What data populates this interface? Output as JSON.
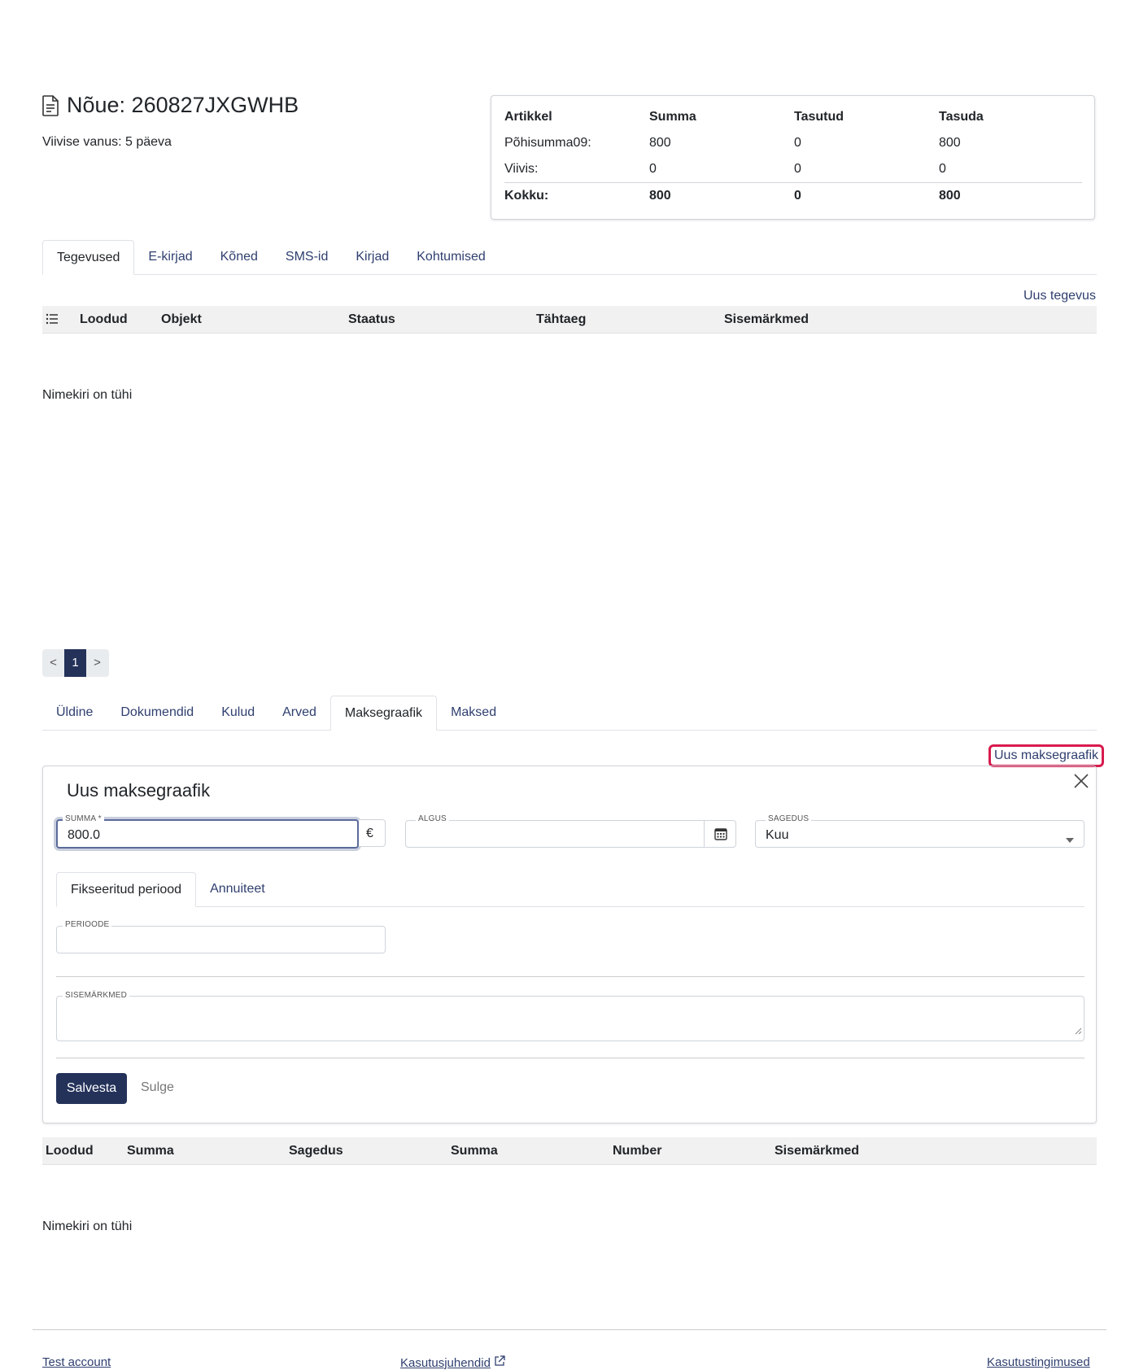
{
  "header": {
    "title": "Nõue: 260827JXGWHB",
    "age_text": "Viivise vanus: 5 päeva"
  },
  "summary": {
    "columns": [
      "Artikkel",
      "Summa",
      "Tasutud",
      "Tasuda"
    ],
    "rows": [
      [
        "Põhisumma09:",
        "800",
        "0",
        "800"
      ],
      [
        "Viivis:",
        "0",
        "0",
        "0"
      ]
    ],
    "total": [
      "Kokku:",
      "800",
      "0",
      "800"
    ]
  },
  "activity_tabs": [
    "Tegevused",
    "E-kirjad",
    "Kõned",
    "SMS-id",
    "Kirjad",
    "Kohtumised"
  ],
  "activity": {
    "new_link": "Uus tegevus",
    "columns": [
      "Loodud",
      "Objekt",
      "Staatus",
      "Tähtaeg",
      "Sisemärkmed"
    ],
    "empty": "Nimekiri on tühi"
  },
  "pager": {
    "prev": "<",
    "current": "1",
    "next": ">"
  },
  "detail_tabs": [
    "Üldine",
    "Dokumendid",
    "Kulud",
    "Arved",
    "Maksegraafik",
    "Maksed"
  ],
  "schedule": {
    "new_link": "Uus maksegraafik",
    "form_title": "Uus maksegraafik",
    "amount_label": "SUMMA *",
    "amount_value": "800.0",
    "currency": "€",
    "start_label": "ALGUS",
    "start_value": "",
    "frequency_label": "SAGEDUS",
    "frequency_value": "Kuu",
    "subtabs": [
      "Fikseeritud periood",
      "Annuiteet"
    ],
    "periods_label": "PERIOODE",
    "notes_label": "SISEMÄRKMED",
    "save": "Salvesta",
    "close": "Sulge",
    "columns": [
      "Loodud",
      "Summa",
      "Sagedus",
      "Summa",
      "Number",
      "Sisemärkmed"
    ],
    "empty": "Nimekiri on tühi"
  },
  "footer": {
    "left": "Test account",
    "center": "Kasutusjuhendid",
    "right": "Kasutustingimused"
  }
}
